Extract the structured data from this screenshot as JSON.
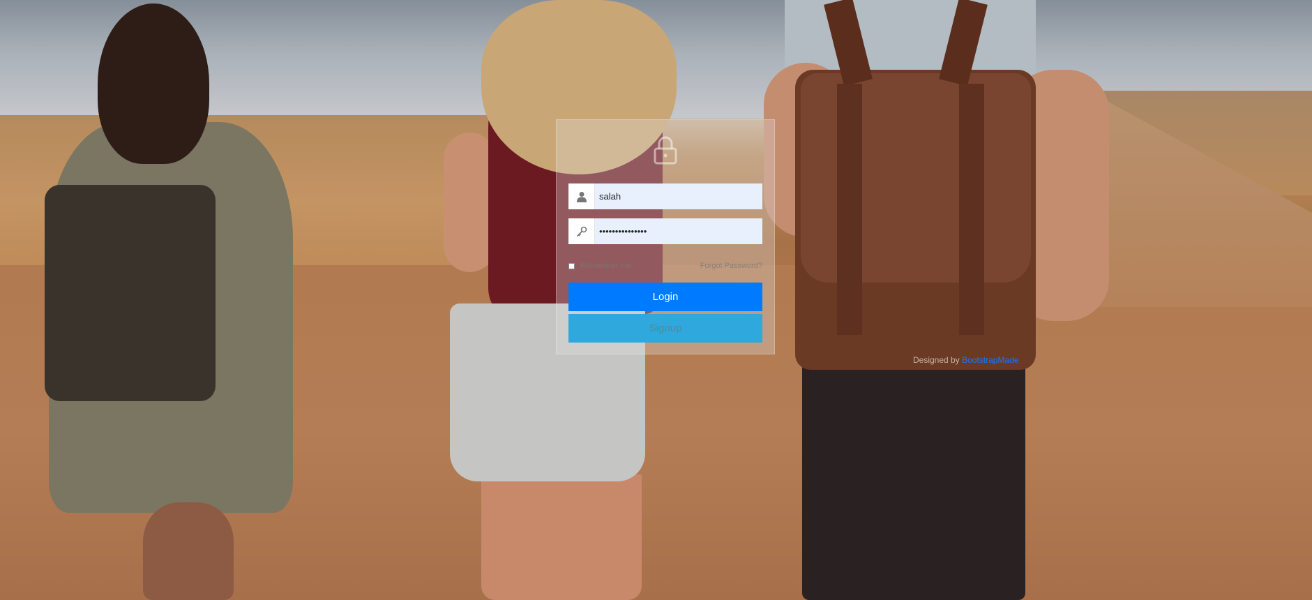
{
  "login": {
    "lock_icon": "lock-icon",
    "username": {
      "icon": "user-icon",
      "value": "salah"
    },
    "password": {
      "icon": "key-icon",
      "value": "•••••••••••••••"
    },
    "remember_label": "Remember me",
    "forgot_label": "Forgot Password?",
    "login_label": "Login",
    "signup_label": "Signup"
  },
  "footer": {
    "designed_by": "Designed by",
    "brand": "BootstrapMade"
  },
  "colors": {
    "login_button": "#007bff",
    "signup_button": "#2ea8dd",
    "input_background": "#e8f0fe",
    "brand_link": "#1a73ff"
  }
}
